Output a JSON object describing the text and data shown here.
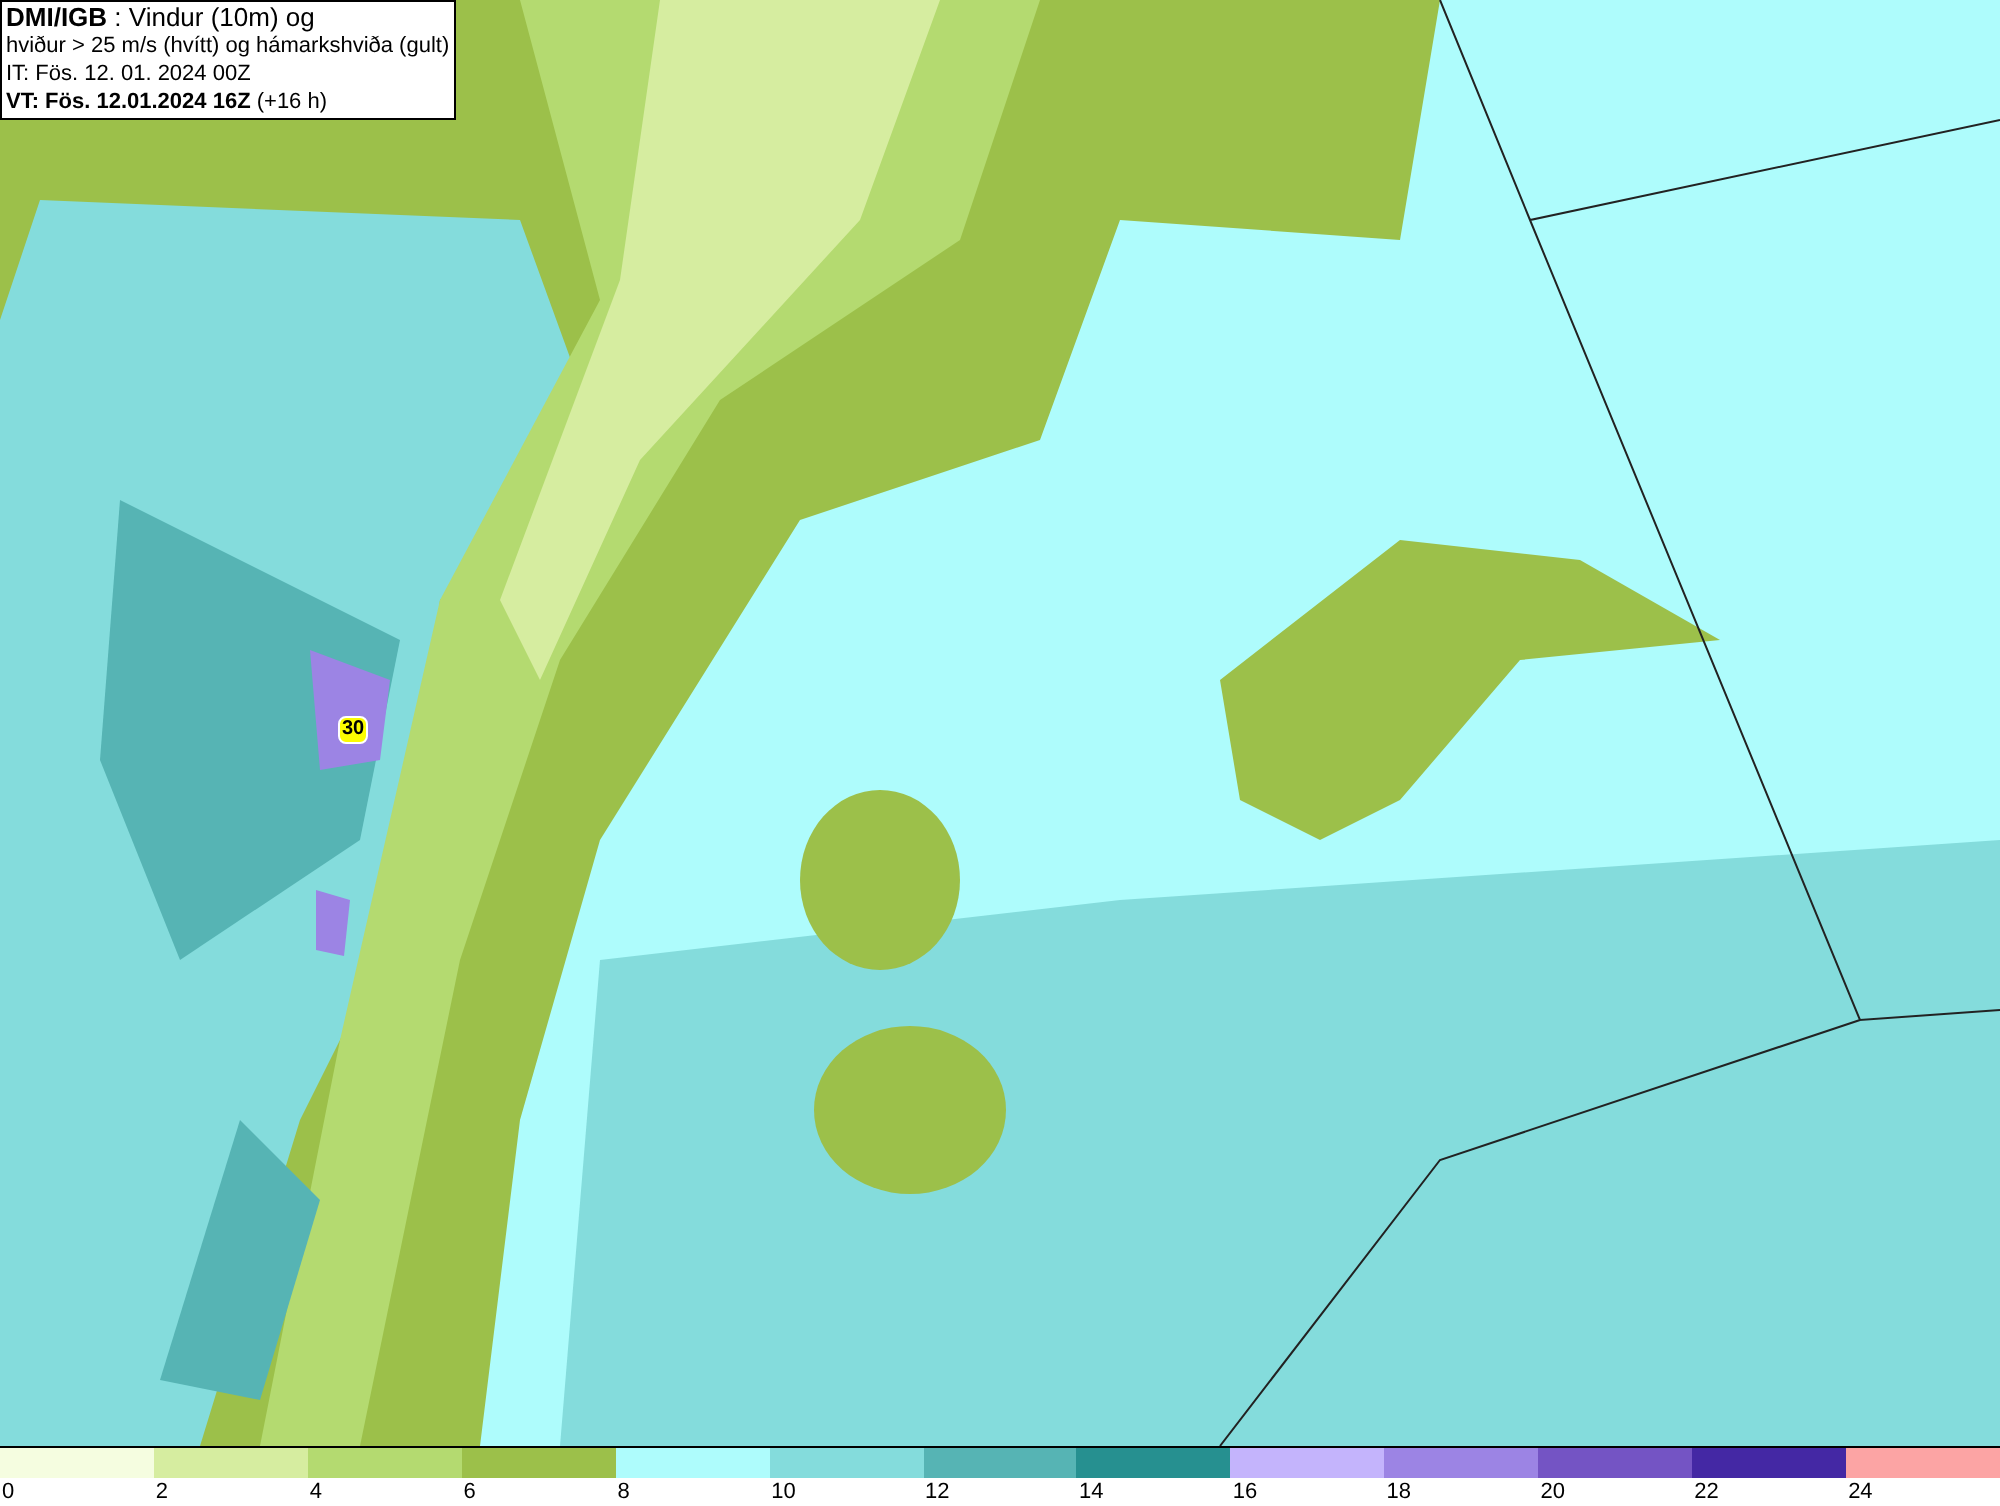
{
  "legend": {
    "lines": [
      "**DMI/IGB** : Vindur (10m) og",
      "hviður > 25 m/s (hvítt) og hámarkshviða (gult)",
      "IT: Fös. 12. 01. 2024 00Z",
      "**VT: Fös. 12.01.2024 16Z** (+16 h)"
    ]
  },
  "map": {
    "gust_label": "30"
  },
  "colorbar": [
    {
      "label": "0",
      "color": "#f5fde0"
    },
    {
      "label": "2",
      "color": "#d6eda0"
    },
    {
      "label": "4",
      "color": "#b4da70"
    },
    {
      "label": "6",
      "color": "#9cc04a"
    },
    {
      "label": "8",
      "color": "#aefcfc"
    },
    {
      "label": "10",
      "color": "#84dcdc"
    },
    {
      "label": "12",
      "color": "#56b4b4"
    },
    {
      "label": "14",
      "color": "#269090"
    },
    {
      "label": "16",
      "color": "#c4b4fc"
    },
    {
      "label": "18",
      "color": "#9c84e4"
    },
    {
      "label": "20",
      "color": "#7454c4"
    },
    {
      "label": "22",
      "color": "#4428a4"
    },
    {
      "label": "24",
      "color": "#fca4a4"
    }
  ]
}
